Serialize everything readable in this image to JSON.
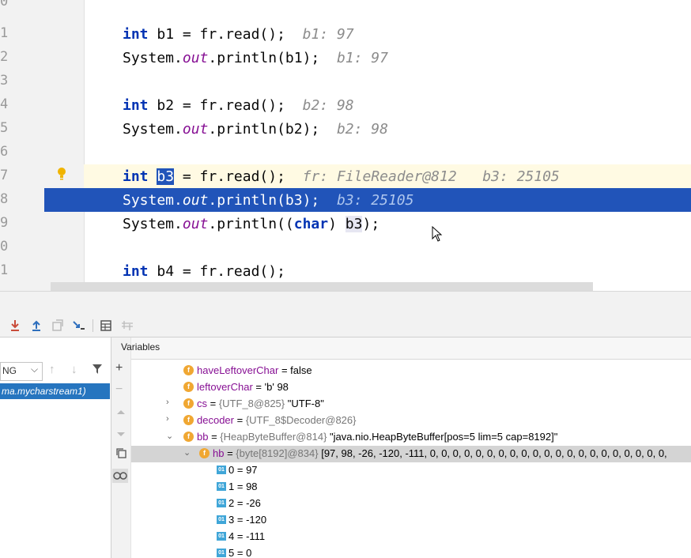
{
  "editor": {
    "line_numbers": [
      "0",
      "1",
      "2",
      "3",
      "4",
      "5",
      "6",
      "7",
      "8",
      "9",
      "0",
      "1"
    ],
    "lines": [
      {
        "kw": "int",
        "name": "b1",
        "rest": " = fr.read();",
        "hint": "b1: 97"
      },
      {
        "sys": "System.",
        "out": "out",
        "rest": ".println(b1);",
        "hint": "b1: 97"
      },
      {
        "kw": "int",
        "name": "b2",
        "rest": " = fr.read();",
        "hint": "b2: 98"
      },
      {
        "sys": "System.",
        "out": "out",
        "rest": ".println(b2);",
        "hint": "b2: 98"
      },
      {
        "kw": "int",
        "name": "b3",
        "rest": " = fr.read();",
        "hint1": "fr: FileReader@812",
        "hint2": "b3: 25105"
      },
      {
        "sys": "System.",
        "out": "out",
        "rest": ".println(b3);",
        "hint": "b3: 25105"
      },
      {
        "sys": "System.",
        "out": "out",
        "pre": ".println((",
        "kw": "char",
        "post": ") ",
        "ref": "b3",
        "end": ");"
      },
      {
        "kw": "int",
        "name": "b4",
        "rest": " = fr.read();"
      }
    ]
  },
  "vars_panel": {
    "title": "Variables",
    "thread_select": "NG",
    "frame": "ma.mycharstream1)",
    "rows": [
      {
        "name": "haveLeftoverChar",
        "eq": " = ",
        "value": "false"
      },
      {
        "name": "leftoverChar",
        "eq": " = ",
        "value": "'b' 98"
      },
      {
        "name": "cs",
        "eq": " = ",
        "type": "{UTF_8@825}",
        "value": " \"UTF-8\""
      },
      {
        "name": "decoder",
        "eq": " = ",
        "type": "{UTF_8$Decoder@826}"
      },
      {
        "name": "bb",
        "eq": " = ",
        "type": "{HeapByteBuffer@814}",
        "value": " \"java.nio.HeapByteBuffer[pos=5 lim=5 cap=8192]\""
      },
      {
        "name": "hb",
        "eq": " = ",
        "type": "{byte[8192]@834}",
        "value": " [97, 98, -26, -120, -111, 0, 0, 0, 0, 0, 0, 0, 0, 0, 0, 0, 0, 0, 0, 0, 0, 0, 0, 0, 0, 0,"
      },
      {
        "idx": "0",
        "eq": " = ",
        "value": "97"
      },
      {
        "idx": "1",
        "eq": " = ",
        "value": "98"
      },
      {
        "idx": "2",
        "eq": " = ",
        "value": "-26"
      },
      {
        "idx": "3",
        "eq": " = ",
        "value": "-120"
      },
      {
        "idx": "4",
        "eq": " = ",
        "value": "-111"
      },
      {
        "idx": "5",
        "eq": " = ",
        "value": "0"
      }
    ]
  },
  "icons": {
    "field": "f",
    "array_elem": "01",
    "expand": "›",
    "collapse": "⌄"
  },
  "colors": {
    "exec_line": "#2154b9",
    "current_line": "#fffae3",
    "field_icon": "#f0a732"
  }
}
